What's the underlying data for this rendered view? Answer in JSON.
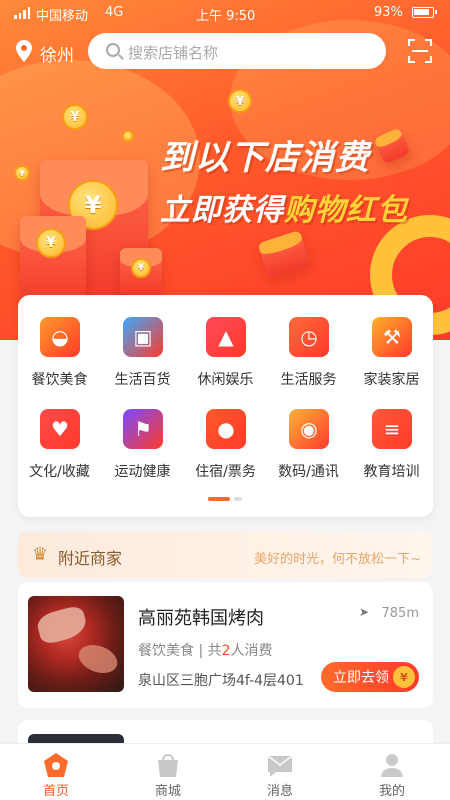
{
  "status_bar": {
    "carrier": "中国移动",
    "network": "4G",
    "time": "上午 9:50",
    "battery": "93%"
  },
  "header": {
    "city": "徐州",
    "search_placeholder": "搜索店铺名称"
  },
  "banner": {
    "line1": "到以下店消费",
    "line2_prefix": "立即获得",
    "line2_highlight": "购物红包",
    "coin_symbol": "¥"
  },
  "categories": [
    {
      "label": "餐饮美食",
      "icon": "food-icon",
      "color": "#ff9b2a"
    },
    {
      "label": "生活百货",
      "icon": "shopping-bag-icon",
      "color": "#3aa8ff"
    },
    {
      "label": "休闲娱乐",
      "icon": "play-icon",
      "color": "#ff4a5a"
    },
    {
      "label": "生活服务",
      "icon": "clock-icon",
      "color": "#ff6a3a"
    },
    {
      "label": "家装家居",
      "icon": "hammer-icon",
      "color": "#ffb02a"
    },
    {
      "label": "文化/收藏",
      "icon": "heart-icon",
      "color": "#ff4a4a"
    },
    {
      "label": "运动健康",
      "icon": "fitness-icon",
      "color": "#7a4aff"
    },
    {
      "label": "住宿/票务",
      "icon": "pin-icon",
      "color": "#ff5a2a"
    },
    {
      "label": "数码/通讯",
      "icon": "camera-icon",
      "color": "#ffb23a"
    },
    {
      "label": "教育培训",
      "icon": "chat-icon",
      "color": "#ff5a3a"
    }
  ],
  "nearby": {
    "title": "附近商家",
    "slogan": "美好的时光，何不放松一下~"
  },
  "shop": {
    "name": "高丽苑韩国烤肉",
    "distance": "785m",
    "category": "餐饮美食",
    "separator": "|",
    "count_prefix": "共",
    "count": "2",
    "count_suffix": "人消费",
    "address": "泉山区三胞广场4f-4层401",
    "action": "立即去领",
    "action_badge": "¥"
  },
  "tabs": [
    {
      "label": "首页",
      "icon": "home-icon",
      "active": true
    },
    {
      "label": "商城",
      "icon": "mall-icon",
      "active": false
    },
    {
      "label": "消息",
      "icon": "message-icon",
      "active": false
    },
    {
      "label": "我的",
      "icon": "profile-icon",
      "active": false
    }
  ],
  "colors": {
    "accent": "#ff5a2a",
    "banner_bg": "#ff4a2a",
    "highlight": "#ffd23a"
  }
}
